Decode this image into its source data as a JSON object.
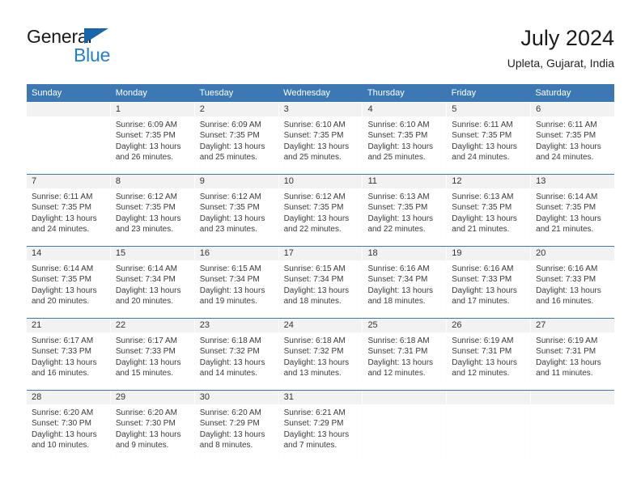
{
  "brand": {
    "word1": "General",
    "word2": "Blue",
    "triangle_color": "#1665ad",
    "blue_color": "#1f7fd1"
  },
  "header": {
    "title": "July 2024",
    "location": "Upleta, Gujarat, India"
  },
  "theme": {
    "header_blue": "#3c78b4",
    "daynum_band": "#f2f2f2",
    "text": "#3a3a3a"
  },
  "weekday_headers": [
    "Sunday",
    "Monday",
    "Tuesday",
    "Wednesday",
    "Thursday",
    "Friday",
    "Saturday"
  ],
  "weeks": [
    [
      {
        "day": "",
        "sunrise": "",
        "sunset": "",
        "daylight_l1": "",
        "daylight_l2": ""
      },
      {
        "day": "1",
        "sunrise": "Sunrise: 6:09 AM",
        "sunset": "Sunset: 7:35 PM",
        "daylight_l1": "Daylight: 13 hours",
        "daylight_l2": "and 26 minutes."
      },
      {
        "day": "2",
        "sunrise": "Sunrise: 6:09 AM",
        "sunset": "Sunset: 7:35 PM",
        "daylight_l1": "Daylight: 13 hours",
        "daylight_l2": "and 25 minutes."
      },
      {
        "day": "3",
        "sunrise": "Sunrise: 6:10 AM",
        "sunset": "Sunset: 7:35 PM",
        "daylight_l1": "Daylight: 13 hours",
        "daylight_l2": "and 25 minutes."
      },
      {
        "day": "4",
        "sunrise": "Sunrise: 6:10 AM",
        "sunset": "Sunset: 7:35 PM",
        "daylight_l1": "Daylight: 13 hours",
        "daylight_l2": "and 25 minutes."
      },
      {
        "day": "5",
        "sunrise": "Sunrise: 6:11 AM",
        "sunset": "Sunset: 7:35 PM",
        "daylight_l1": "Daylight: 13 hours",
        "daylight_l2": "and 24 minutes."
      },
      {
        "day": "6",
        "sunrise": "Sunrise: 6:11 AM",
        "sunset": "Sunset: 7:35 PM",
        "daylight_l1": "Daylight: 13 hours",
        "daylight_l2": "and 24 minutes."
      }
    ],
    [
      {
        "day": "7",
        "sunrise": "Sunrise: 6:11 AM",
        "sunset": "Sunset: 7:35 PM",
        "daylight_l1": "Daylight: 13 hours",
        "daylight_l2": "and 24 minutes."
      },
      {
        "day": "8",
        "sunrise": "Sunrise: 6:12 AM",
        "sunset": "Sunset: 7:35 PM",
        "daylight_l1": "Daylight: 13 hours",
        "daylight_l2": "and 23 minutes."
      },
      {
        "day": "9",
        "sunrise": "Sunrise: 6:12 AM",
        "sunset": "Sunset: 7:35 PM",
        "daylight_l1": "Daylight: 13 hours",
        "daylight_l2": "and 23 minutes."
      },
      {
        "day": "10",
        "sunrise": "Sunrise: 6:12 AM",
        "sunset": "Sunset: 7:35 PM",
        "daylight_l1": "Daylight: 13 hours",
        "daylight_l2": "and 22 minutes."
      },
      {
        "day": "11",
        "sunrise": "Sunrise: 6:13 AM",
        "sunset": "Sunset: 7:35 PM",
        "daylight_l1": "Daylight: 13 hours",
        "daylight_l2": "and 22 minutes."
      },
      {
        "day": "12",
        "sunrise": "Sunrise: 6:13 AM",
        "sunset": "Sunset: 7:35 PM",
        "daylight_l1": "Daylight: 13 hours",
        "daylight_l2": "and 21 minutes."
      },
      {
        "day": "13",
        "sunrise": "Sunrise: 6:14 AM",
        "sunset": "Sunset: 7:35 PM",
        "daylight_l1": "Daylight: 13 hours",
        "daylight_l2": "and 21 minutes."
      }
    ],
    [
      {
        "day": "14",
        "sunrise": "Sunrise: 6:14 AM",
        "sunset": "Sunset: 7:35 PM",
        "daylight_l1": "Daylight: 13 hours",
        "daylight_l2": "and 20 minutes."
      },
      {
        "day": "15",
        "sunrise": "Sunrise: 6:14 AM",
        "sunset": "Sunset: 7:34 PM",
        "daylight_l1": "Daylight: 13 hours",
        "daylight_l2": "and 20 minutes."
      },
      {
        "day": "16",
        "sunrise": "Sunrise: 6:15 AM",
        "sunset": "Sunset: 7:34 PM",
        "daylight_l1": "Daylight: 13 hours",
        "daylight_l2": "and 19 minutes."
      },
      {
        "day": "17",
        "sunrise": "Sunrise: 6:15 AM",
        "sunset": "Sunset: 7:34 PM",
        "daylight_l1": "Daylight: 13 hours",
        "daylight_l2": "and 18 minutes."
      },
      {
        "day": "18",
        "sunrise": "Sunrise: 6:16 AM",
        "sunset": "Sunset: 7:34 PM",
        "daylight_l1": "Daylight: 13 hours",
        "daylight_l2": "and 18 minutes."
      },
      {
        "day": "19",
        "sunrise": "Sunrise: 6:16 AM",
        "sunset": "Sunset: 7:33 PM",
        "daylight_l1": "Daylight: 13 hours",
        "daylight_l2": "and 17 minutes."
      },
      {
        "day": "20",
        "sunrise": "Sunrise: 6:16 AM",
        "sunset": "Sunset: 7:33 PM",
        "daylight_l1": "Daylight: 13 hours",
        "daylight_l2": "and 16 minutes."
      }
    ],
    [
      {
        "day": "21",
        "sunrise": "Sunrise: 6:17 AM",
        "sunset": "Sunset: 7:33 PM",
        "daylight_l1": "Daylight: 13 hours",
        "daylight_l2": "and 16 minutes."
      },
      {
        "day": "22",
        "sunrise": "Sunrise: 6:17 AM",
        "sunset": "Sunset: 7:33 PM",
        "daylight_l1": "Daylight: 13 hours",
        "daylight_l2": "and 15 minutes."
      },
      {
        "day": "23",
        "sunrise": "Sunrise: 6:18 AM",
        "sunset": "Sunset: 7:32 PM",
        "daylight_l1": "Daylight: 13 hours",
        "daylight_l2": "and 14 minutes."
      },
      {
        "day": "24",
        "sunrise": "Sunrise: 6:18 AM",
        "sunset": "Sunset: 7:32 PM",
        "daylight_l1": "Daylight: 13 hours",
        "daylight_l2": "and 13 minutes."
      },
      {
        "day": "25",
        "sunrise": "Sunrise: 6:18 AM",
        "sunset": "Sunset: 7:31 PM",
        "daylight_l1": "Daylight: 13 hours",
        "daylight_l2": "and 12 minutes."
      },
      {
        "day": "26",
        "sunrise": "Sunrise: 6:19 AM",
        "sunset": "Sunset: 7:31 PM",
        "daylight_l1": "Daylight: 13 hours",
        "daylight_l2": "and 12 minutes."
      },
      {
        "day": "27",
        "sunrise": "Sunrise: 6:19 AM",
        "sunset": "Sunset: 7:31 PM",
        "daylight_l1": "Daylight: 13 hours",
        "daylight_l2": "and 11 minutes."
      }
    ],
    [
      {
        "day": "28",
        "sunrise": "Sunrise: 6:20 AM",
        "sunset": "Sunset: 7:30 PM",
        "daylight_l1": "Daylight: 13 hours",
        "daylight_l2": "and 10 minutes."
      },
      {
        "day": "29",
        "sunrise": "Sunrise: 6:20 AM",
        "sunset": "Sunset: 7:30 PM",
        "daylight_l1": "Daylight: 13 hours",
        "daylight_l2": "and 9 minutes."
      },
      {
        "day": "30",
        "sunrise": "Sunrise: 6:20 AM",
        "sunset": "Sunset: 7:29 PM",
        "daylight_l1": "Daylight: 13 hours",
        "daylight_l2": "and 8 minutes."
      },
      {
        "day": "31",
        "sunrise": "Sunrise: 6:21 AM",
        "sunset": "Sunset: 7:29 PM",
        "daylight_l1": "Daylight: 13 hours",
        "daylight_l2": "and 7 minutes."
      },
      {
        "day": "",
        "sunrise": "",
        "sunset": "",
        "daylight_l1": "",
        "daylight_l2": ""
      },
      {
        "day": "",
        "sunrise": "",
        "sunset": "",
        "daylight_l1": "",
        "daylight_l2": ""
      },
      {
        "day": "",
        "sunrise": "",
        "sunset": "",
        "daylight_l1": "",
        "daylight_l2": ""
      }
    ]
  ]
}
